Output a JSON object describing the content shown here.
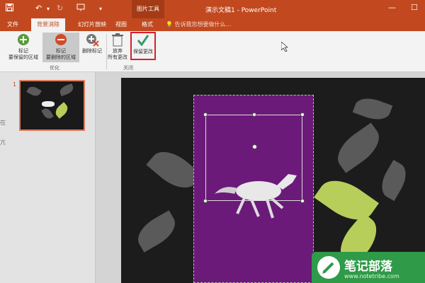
{
  "window": {
    "title": "演示文稿1 - PowerPoint",
    "context_tools": "图片工具",
    "search_placeholder": "告诉我您想要做什么...",
    "qat": {
      "undo": "↶",
      "redo": "↻"
    },
    "controls": {
      "minimize": "—",
      "restore": "☐"
    }
  },
  "tabs": [
    {
      "label": "文件"
    },
    {
      "label": "背景消除"
    },
    {
      "label": "幻灯片放映"
    },
    {
      "label": "视图"
    },
    {
      "label": "格式"
    }
  ],
  "ribbon": {
    "buttons": [
      {
        "label_l1": "标记",
        "label_l2": "要保留的区域",
        "icon": "plus-circle-icon"
      },
      {
        "label_l1": "标记",
        "label_l2": "要删除的区域",
        "icon": "minus-circle-icon"
      },
      {
        "label_l1": "删除标记",
        "label_l2": "",
        "icon": "delete-mark-icon"
      },
      {
        "label_l1": "放弃",
        "label_l2": "所有更改",
        "icon": "trash-icon"
      },
      {
        "label_l1": "保留更改",
        "label_l2": "",
        "icon": "checkmark-icon"
      }
    ],
    "groups": [
      {
        "label": "优化"
      },
      {
        "label": "关闭"
      }
    ]
  },
  "slides": [
    {
      "number": "1"
    }
  ],
  "left_edge_chars": [
    "在",
    "亢"
  ],
  "watermark": {
    "text": "笔记部落",
    "url": "www.notetribe.com"
  },
  "colors": {
    "accent": "#c2491f",
    "purple_area": "#6b1a7a",
    "highlight_box": "#d6202a",
    "watermark": "#2f9a48"
  }
}
